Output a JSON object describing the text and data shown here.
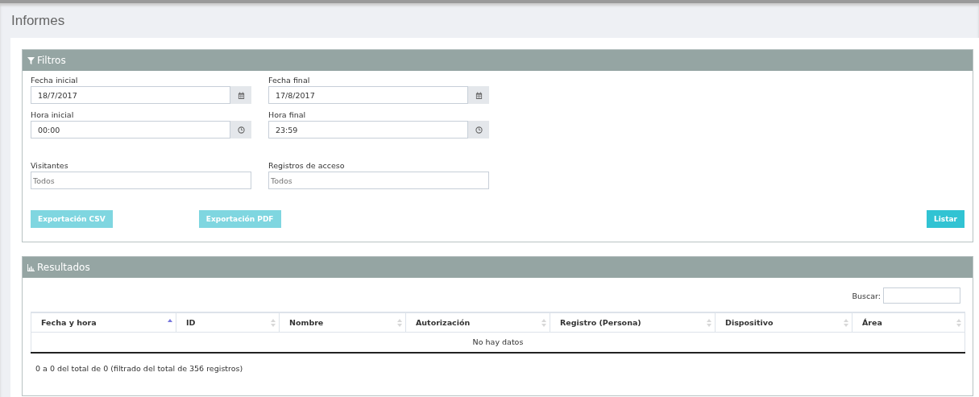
{
  "page_title": "Informes",
  "filters": {
    "title": "Filtros",
    "fields": [
      {
        "kind": "date",
        "label": "Fecha inicial",
        "value": "18/7/2017"
      },
      {
        "kind": "date",
        "label": "Fecha final",
        "value": "17/8/2017"
      },
      {
        "kind": "time",
        "label": "Hora inicial",
        "value": "00:00"
      },
      {
        "kind": "time",
        "label": "Hora final",
        "value": "23:59"
      },
      {
        "kind": "text",
        "label": "Visitantes",
        "placeholder": "Todos"
      },
      {
        "kind": "text",
        "label": "Registros de acceso",
        "placeholder": "Todos"
      }
    ],
    "buttons": [
      {
        "label": "Exportación CSV",
        "disabled": true
      },
      {
        "label": "Exportación PDF",
        "disabled": true
      },
      {
        "label": "Listar",
        "disabled": false
      }
    ]
  },
  "results": {
    "title": "Resultados",
    "search_label": "Buscar:",
    "columns": [
      {
        "label": "Fecha y hora",
        "sorted": true
      },
      {
        "label": "ID",
        "sorted": false
      },
      {
        "label": "Nombre",
        "sorted": false
      },
      {
        "label": "Autorización",
        "sorted": false
      },
      {
        "label": "Registro (Persona)",
        "sorted": false
      },
      {
        "label": "Dispositivo",
        "sorted": false
      },
      {
        "label": "Área",
        "sorted": false
      }
    ],
    "empty_message": "No hay datos",
    "info": "0 a 0 del total de 0 (filtrado del total de 356 registros)"
  }
}
